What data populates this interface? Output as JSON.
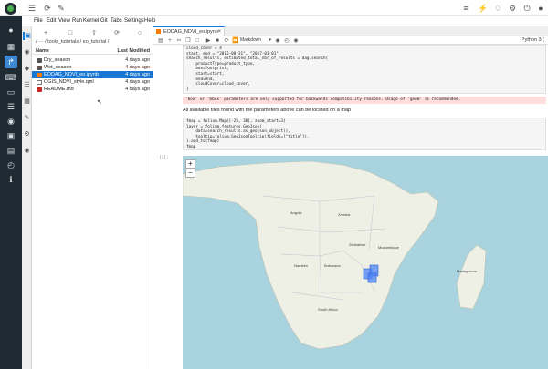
{
  "app": {
    "menu": [
      "File",
      "Edit",
      "View",
      "Run",
      "Kernel",
      "Git",
      "Tabs",
      "Settings",
      "Help"
    ]
  },
  "filebrowser": {
    "breadcrumb": "/ ··· / tools_tutorials / eo_tutorial /",
    "col_name": "Name",
    "col_modified": "Last Modified",
    "files": [
      {
        "name": "Dry_season",
        "modified": "4 days ago",
        "type": "folder",
        "selected": false
      },
      {
        "name": "Wet_season",
        "modified": "4 days ago",
        "type": "folder",
        "selected": false
      },
      {
        "name": "EODAG_NDVI_eo.ipynb",
        "modified": "4 days ago",
        "type": "notebook",
        "selected": true
      },
      {
        "name": "OGIS_NDVI_style.qml",
        "modified": "4 days ago",
        "type": "file",
        "selected": false
      },
      {
        "name": "README.md",
        "modified": "4 days ago",
        "type": "markdown",
        "selected": false
      }
    ]
  },
  "notebook": {
    "tab_title": "EODAG_NDVI_eo.ipynb",
    "cell_type": "Markdown",
    "kernel": "Python 3 (",
    "code1": "cloud_cover = 4\nstart, end = \"2016-08-31\", \"2017-01-01\"\nsearch_results, estimated_total_nbr_of_results = dag.search(\n    productType=product_type,\n    box=footprint,\n    start=start,\n    end=end,\n    cloudCover=cloud_cover,\n)",
    "warning": "'box' or 'bbox' parameters are only supported for backwards compatibility reasons. Usage of 'geom' is recommended.",
    "markdown_text": "All available tiles found with the parameters above can be located on a map",
    "code2": "fmap = folium.Map([-25, 30], zoom_start=3)\nlayer = folium.features.GeoJson(\n    data=search_results.as_geojson_object(),\n    tooltip=folium.GeoJsonTooltip(fields=[\"title\"]),\n).add_to(fmap)\nfmap",
    "prompt_output": "[3]:"
  },
  "map": {
    "zoom_in": "+",
    "zoom_out": "−",
    "labels": [
      "Namibia",
      "Botswana",
      "South Africa",
      "Zimbabwe",
      "Mozambique",
      "Madagascar",
      "Angola",
      "Zambia"
    ]
  },
  "colors": {
    "rail": "#1f2a33",
    "accent": "#1976d2",
    "ocean": "#a9d3de",
    "land": "#eef0e6"
  }
}
